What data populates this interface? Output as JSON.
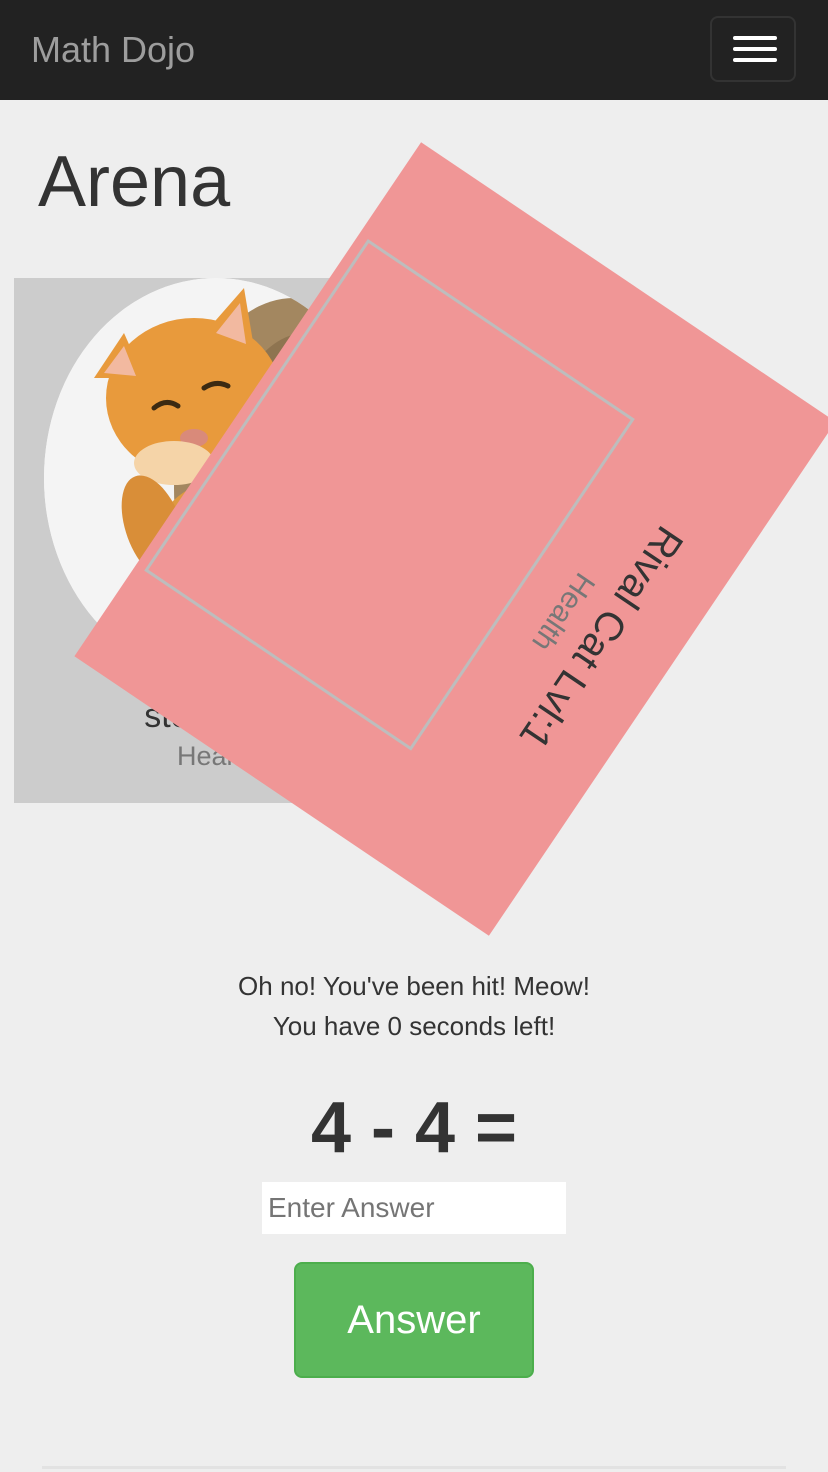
{
  "navbar": {
    "brand": "Math Dojo",
    "menu_icon": "hamburger-menu-icon"
  },
  "arena": {
    "title": "Arena"
  },
  "player": {
    "name": "steve Cat",
    "health_label": "Health",
    "avatar": "orange-cat-photo"
  },
  "rival": {
    "name": "Rival Cat Lvl:1",
    "health_label": "Health"
  },
  "battle": {
    "hit_message": "Oh no! You've been hit! Meow!",
    "timer_message": "You have 0 seconds left!",
    "equation": "4 - 4 ="
  },
  "answer_form": {
    "input_value": "",
    "input_placeholder": "Enter Answer",
    "button_label": "Answer"
  },
  "colors": {
    "navbar_bg": "#222222",
    "brand_text": "#9d9d9d",
    "page_bg": "#eeeeee",
    "player_card_bg": "#cccccc",
    "rival_card_bg": "#f09696",
    "answer_button": "#5cb85c"
  }
}
